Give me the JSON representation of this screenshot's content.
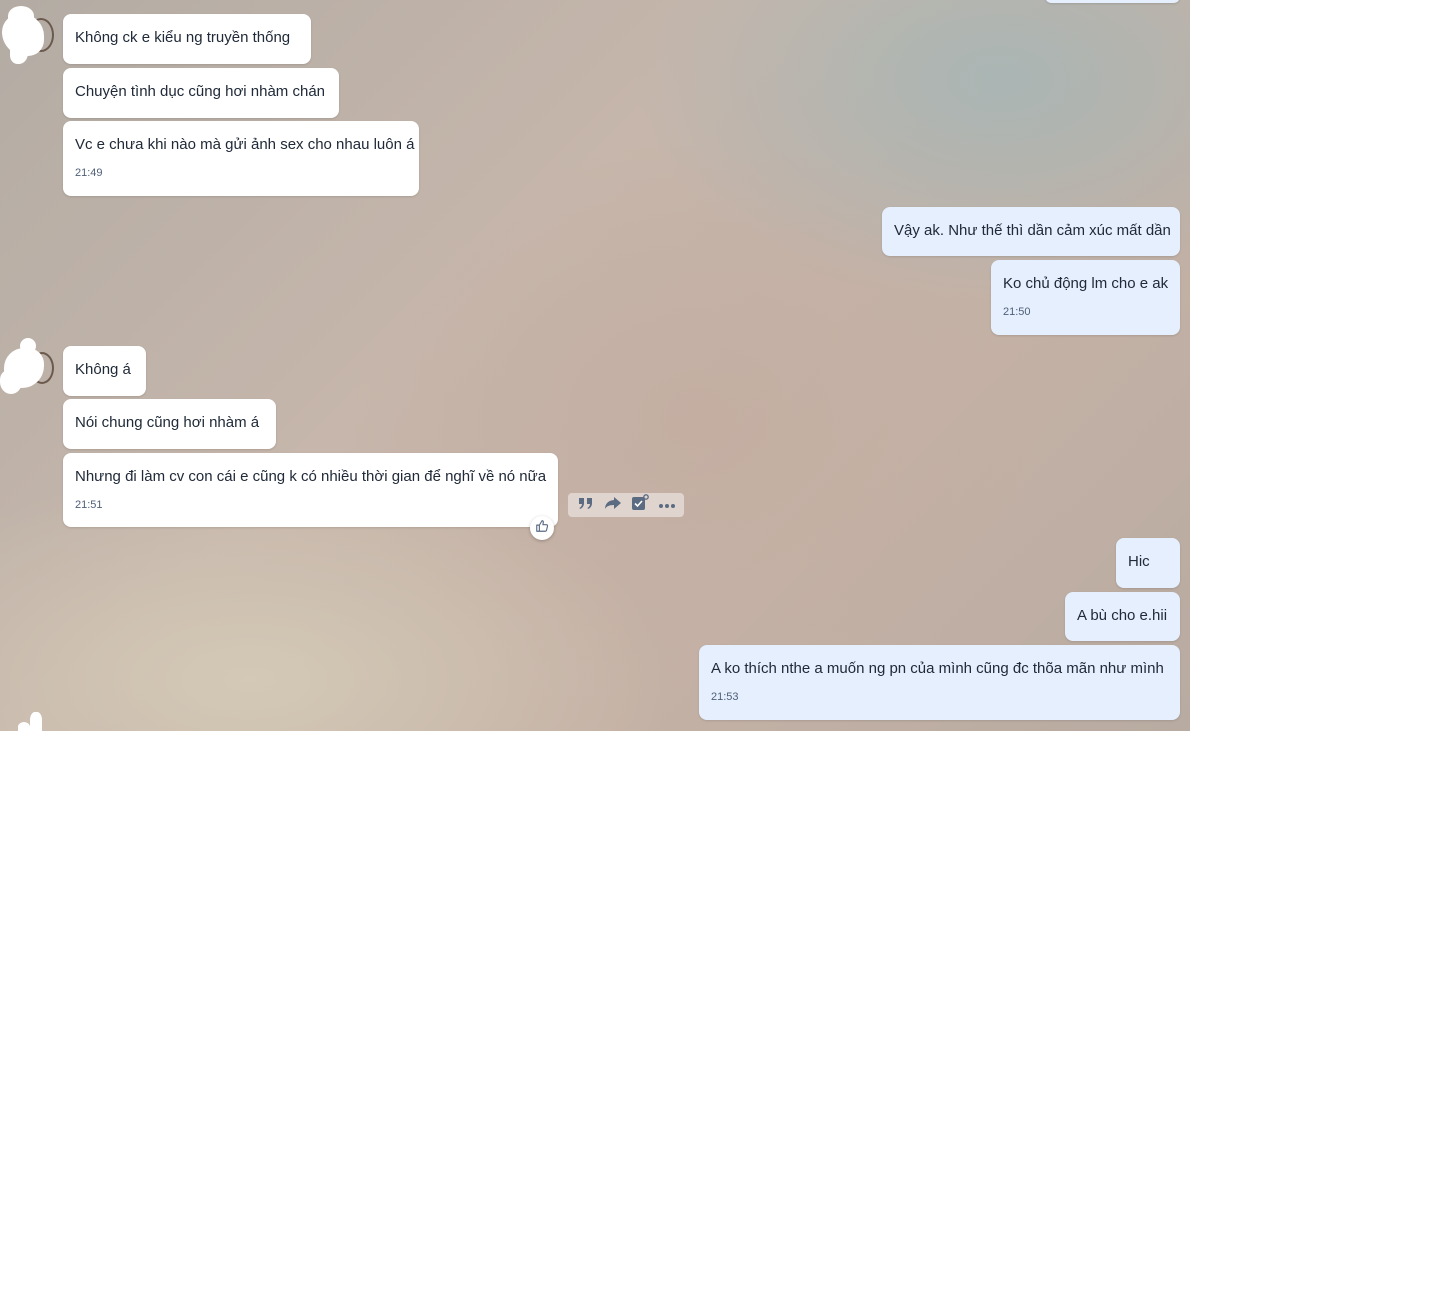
{
  "conversation": {
    "messages": [
      {
        "id": "m1",
        "side": "in",
        "text": "Không ck e kiểu ng truyền thống"
      },
      {
        "id": "m2",
        "side": "in",
        "text": "Chuyện tình dục cũng hơi nhàm chán"
      },
      {
        "id": "m3",
        "side": "in",
        "text": "Vc e chưa khi nào mà gửi ảnh sex cho nhau luôn á",
        "time": "21:49"
      },
      {
        "id": "m4",
        "side": "out",
        "text": "Vậy ak. Như thế thì dần cảm xúc mất dần"
      },
      {
        "id": "m5",
        "side": "out",
        "text": "Ko chủ động lm cho e ak",
        "time": "21:50"
      },
      {
        "id": "m6",
        "side": "in",
        "text": "Không á"
      },
      {
        "id": "m7",
        "side": "in",
        "text": "Nói chung cũng hơi nhàm á"
      },
      {
        "id": "m8",
        "side": "in",
        "text": "Nhưng đi làm cv con cái e cũng k có nhiều thời gian để nghĩ về nó nữa",
        "time": "21:51"
      },
      {
        "id": "m9",
        "side": "out",
        "text": "Hic"
      },
      {
        "id": "m10",
        "side": "out",
        "text": "A bù cho e.hii"
      },
      {
        "id": "m11",
        "side": "out",
        "text": "A ko thích nthe a muốn ng pn của mình cũng đc thõa mãn như mình",
        "time": "21:53"
      }
    ]
  },
  "message_actions": {
    "icons": [
      "quote-icon",
      "forward-icon",
      "task-icon",
      "more-icon"
    ],
    "reaction_icon": "thumbs-up-icon"
  },
  "colors": {
    "incoming_bubble": "#ffffff",
    "outgoing_bubble": "#e5effd",
    "text": "#202a38",
    "time_text": "#4f5f78",
    "action_icon": "#5b6b82"
  }
}
